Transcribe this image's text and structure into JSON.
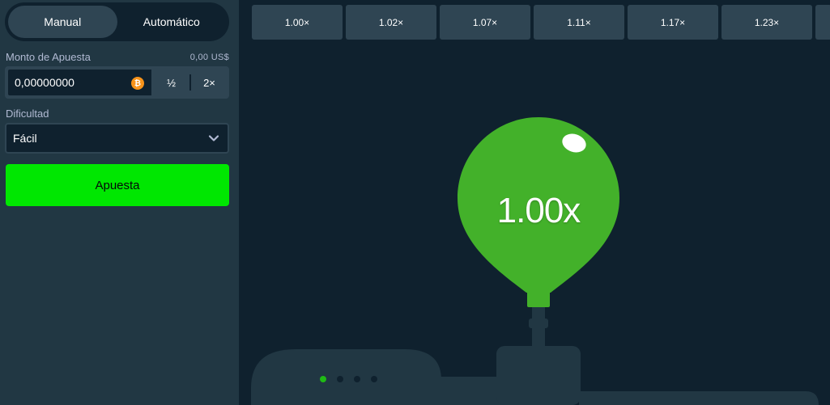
{
  "sidebar": {
    "tabs": [
      {
        "label": "Manual",
        "active": true
      },
      {
        "label": "Automático",
        "active": false
      }
    ],
    "bet_amount": {
      "label": "Monto de Apuesta",
      "usd_value": "0,00 US$",
      "value": "0,00000000",
      "currency_icon": "bitcoin-icon",
      "half_label": "½",
      "double_label": "2×"
    },
    "difficulty": {
      "label": "Dificultad",
      "selected": "Fácil"
    },
    "bet_button_label": "Apuesta"
  },
  "game": {
    "multipliers": [
      "1.00×",
      "1.02×",
      "1.07×",
      "1.11×",
      "1.17×",
      "1.23×"
    ],
    "balloon_multiplier": "1.00x",
    "dots": [
      true,
      false,
      false,
      false
    ],
    "colors": {
      "balloon": "#43b12a",
      "accent": "#00e701",
      "surface": "#2f4553",
      "background": "#0f212e",
      "machine": "#213743"
    }
  }
}
